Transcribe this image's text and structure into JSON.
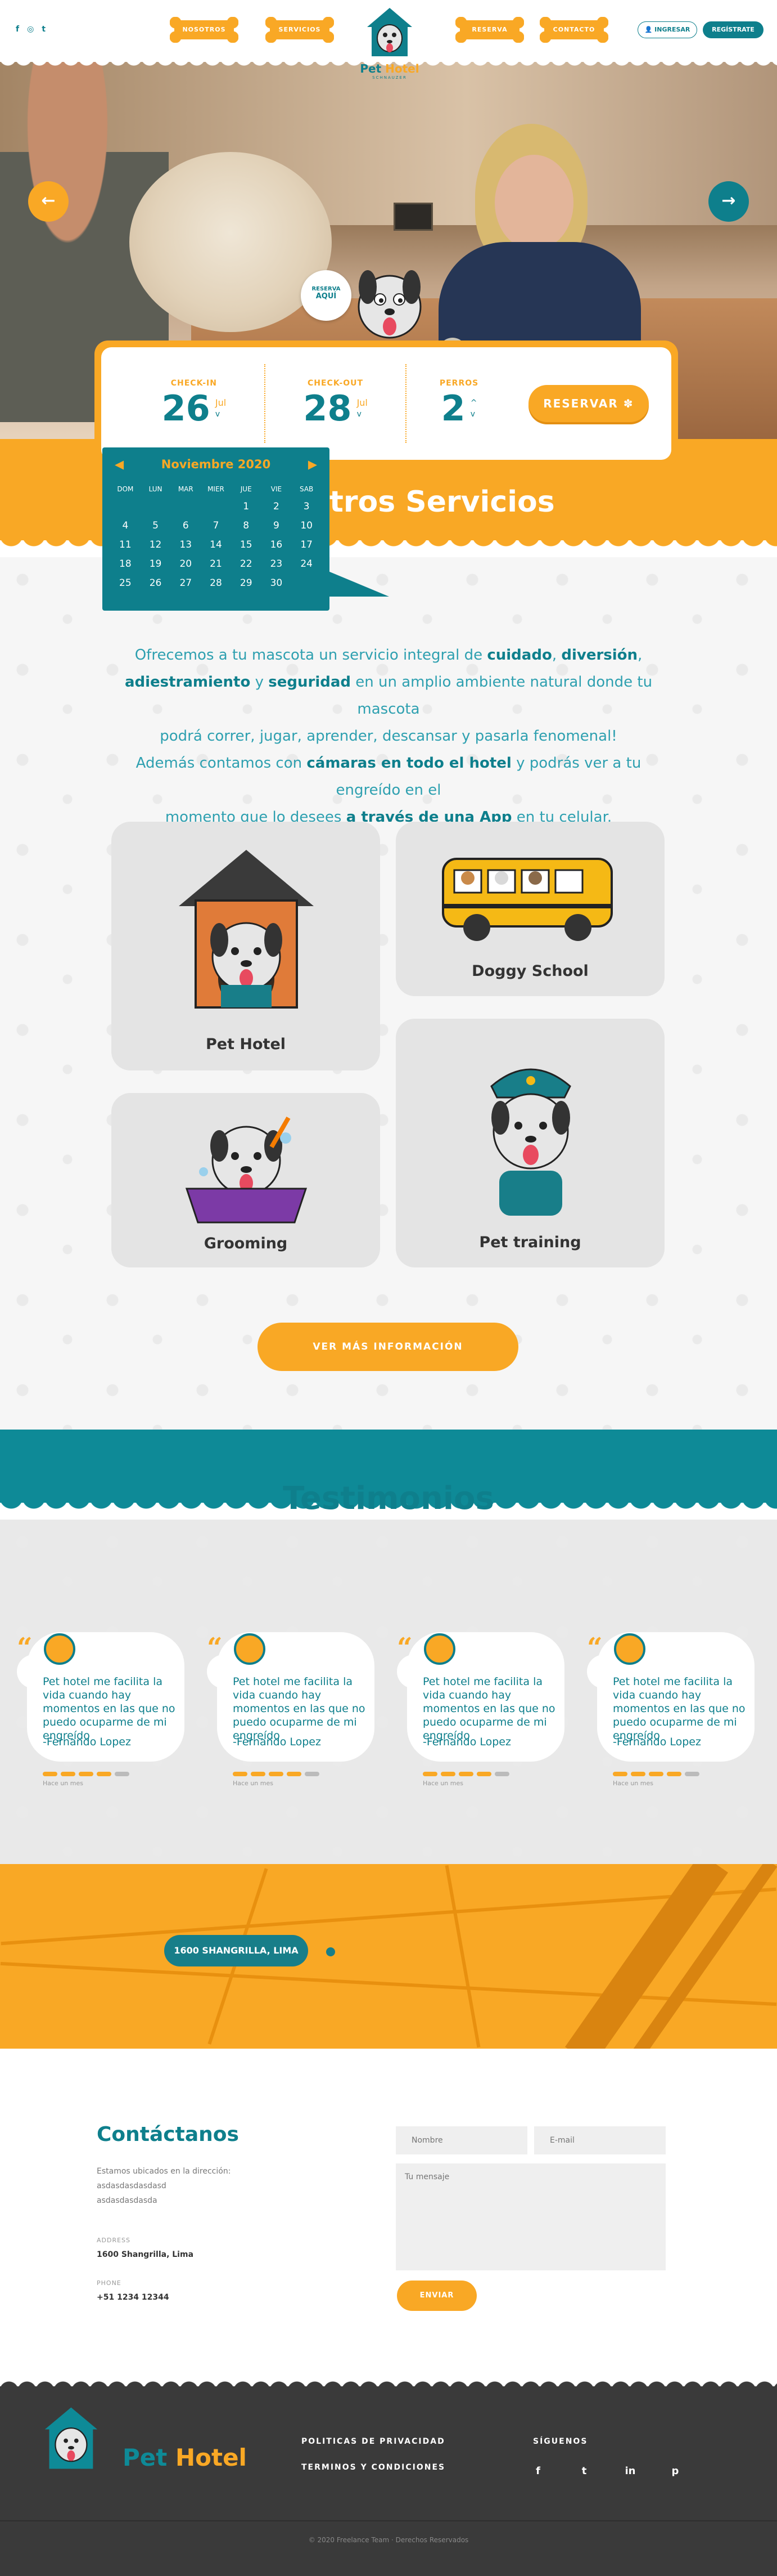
{
  "header": {
    "social": [
      "f",
      "◎",
      "t"
    ],
    "nav": [
      "NOSOTROS",
      "SERVICIOS",
      "RESERVA",
      "CONTACTO"
    ],
    "logo_name_a": "Pet",
    "logo_name_b": "Hotel",
    "logo_sub": "SCHNAUZER",
    "login": "INGRESAR",
    "register": "REGÍSTRATE"
  },
  "hero": {
    "badge_top": "RESERVA",
    "badge_bottom": "AQUÍ",
    "prev": "←",
    "next": "→"
  },
  "booking": {
    "checkin_label": "CHECK-IN",
    "checkin_day": "26",
    "checkin_month": "Jul",
    "checkout_label": "CHECK-OUT",
    "checkout_day": "28",
    "checkout_month": "Jul",
    "pets_label": "PERROS",
    "pets_count": "2",
    "reserve": "RESERVAR"
  },
  "calendar": {
    "month": "Noviembre 2020",
    "dow": [
      "DOM",
      "LUN",
      "MAR",
      "MIER",
      "JUE",
      "VIE",
      "SAB"
    ],
    "days": [
      "",
      "",
      "",
      "",
      "1",
      "2",
      "3",
      "4",
      "5",
      "6",
      "7",
      "8",
      "9",
      "10",
      "11",
      "12",
      "13",
      "14",
      "15",
      "16",
      "17",
      "18",
      "19",
      "20",
      "21",
      "22",
      "23",
      "24",
      "25",
      "26",
      "27",
      "28",
      "29",
      "30",
      ""
    ]
  },
  "services": {
    "title": "Nuestros Servicios",
    "title_visible": "tros Servicios",
    "intro_parts": [
      "Ofrecemos a tu mascota un servicio integral de ",
      "cuidado",
      ", ",
      "diversión",
      ",",
      "adiestramiento",
      " y ",
      "seguridad",
      " en un amplio ambiente natural  donde tu mascota",
      "podrá correr, jugar, aprender, descansar y pasarla fenomenal!",
      "Además contamos con ",
      "cámaras en todo el hotel",
      " y podrás ver a tu engreído en el",
      "momento que lo desees ",
      "a través de una App",
      " en tu celular."
    ],
    "cards": [
      "Pet Hotel",
      "Doggy School",
      "Grooming",
      "Pet training"
    ],
    "more": "VER MÁS INFORMACIÓN"
  },
  "testimonials": {
    "title": "Testimonios",
    "items": [
      {
        "text": "Pet hotel me facilita la vida cuando hay momentos en las que no puedo ocuparme de mi engreído",
        "author": "-Fernando Lopez",
        "date": "Hace un mes"
      },
      {
        "text": "Pet hotel me facilita la vida cuando hay momentos en las que no puedo ocuparme de mi engreído",
        "author": "-Fernando Lopez",
        "date": "Hace un mes"
      },
      {
        "text": "Pet hotel me facilita la vida cuando hay momentos en las que no puedo ocuparme de mi engreído",
        "author": "-Fernando Lopez",
        "date": "Hace un mes"
      },
      {
        "text": "Pet hotel me facilita la vida cuando hay momentos en las que no puedo ocuparme de mi engreído",
        "author": "-Fernando Lopez",
        "date": "Hace un mes"
      }
    ],
    "rating": 4
  },
  "map": {
    "address": "1600 SHANGRILLA, LIMA"
  },
  "contact": {
    "title": "Contáctanos",
    "located": "Estamos ubicados en la dirección:",
    "line1": "asdasdasdasdasd",
    "line2": "asdasdasdasda",
    "addr_label": "ADDRESS",
    "addr": "1600 Shangrilla, Lima",
    "phone_label": "PHONE",
    "phone": "+51 1234 12344",
    "name_ph": "Nombre",
    "email_ph": "E-mail",
    "msg_ph": "Tu mensaje",
    "send": "ENVIAR"
  },
  "footer": {
    "privacy": "POLITICAS DE PRIVACIDAD",
    "terms": "TERMINOS Y CONDICIONES",
    "follow": "SÍGUENOS",
    "icons": [
      "f",
      "t",
      "in",
      "p"
    ],
    "copyright": "© 2020 Freelance Team · Derechos Reservados"
  },
  "colors": {
    "teal": "#0e7f8c",
    "orange": "#f9a825",
    "dark": "#3a3a3a"
  }
}
